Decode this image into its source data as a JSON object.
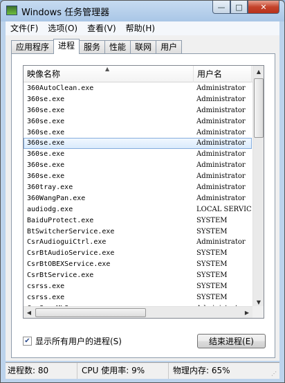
{
  "window": {
    "title": "Windows 任务管理器",
    "min_label": "—",
    "max_label": "□",
    "close_label": "✕"
  },
  "menu": [
    "文件(F)",
    "选项(O)",
    "查看(V)",
    "帮助(H)"
  ],
  "tabs": [
    "应用程序",
    "进程",
    "服务",
    "性能",
    "联网",
    "用户"
  ],
  "active_tab": "进程",
  "columns": {
    "image_name": "映像名称",
    "user_name": "用户名"
  },
  "processes": [
    {
      "name": "360AutoClean.exe",
      "user": "Administrator"
    },
    {
      "name": "360se.exe",
      "user": "Administrator"
    },
    {
      "name": "360se.exe",
      "user": "Administrator"
    },
    {
      "name": "360se.exe",
      "user": "Administrator"
    },
    {
      "name": "360se.exe",
      "user": "Administrator"
    },
    {
      "name": "360se.exe",
      "user": "Administrator",
      "selected": true
    },
    {
      "name": "360se.exe",
      "user": "Administrator"
    },
    {
      "name": "360se.exe",
      "user": "Administrator"
    },
    {
      "name": "360se.exe",
      "user": "Administrator"
    },
    {
      "name": "360tray.exe",
      "user": "Administrator"
    },
    {
      "name": "360WangPan.exe",
      "user": "Administrator"
    },
    {
      "name": "audiodg.exe",
      "user": "LOCAL SERVICE"
    },
    {
      "name": "BaiduProtect.exe",
      "user": "SYSTEM"
    },
    {
      "name": "BtSwitcherService.exe",
      "user": "SYSTEM"
    },
    {
      "name": "CsrAudioguiCtrl.exe",
      "user": "Administrator"
    },
    {
      "name": "CsrBtAudioService.exe",
      "user": "SYSTEM"
    },
    {
      "name": "CsrBtOBEXService.exe",
      "user": "SYSTEM"
    },
    {
      "name": "CsrBtService.exe",
      "user": "SYSTEM"
    },
    {
      "name": "csrss.exe",
      "user": "SYSTEM"
    },
    {
      "name": "csrss.exe",
      "user": "SYSTEM"
    },
    {
      "name": "CsrSyncMLServer.exe",
      "user": "Administrator"
    }
  ],
  "show_all_label": "显示所有用户的进程(S)",
  "show_all_checked": true,
  "end_process_label": "结束进程(E)",
  "status": {
    "processes": "进程数: 80",
    "cpu": "CPU 使用率: 9%",
    "memory": "物理内存: 65%"
  },
  "icons": {
    "sort": "sort-ascending-icon",
    "scroll_up": "scroll-up-icon",
    "scroll_down": "scroll-down-icon",
    "scroll_left": "scroll-left-icon",
    "scroll_right": "scroll-right-icon",
    "check": "checkmark-icon"
  }
}
